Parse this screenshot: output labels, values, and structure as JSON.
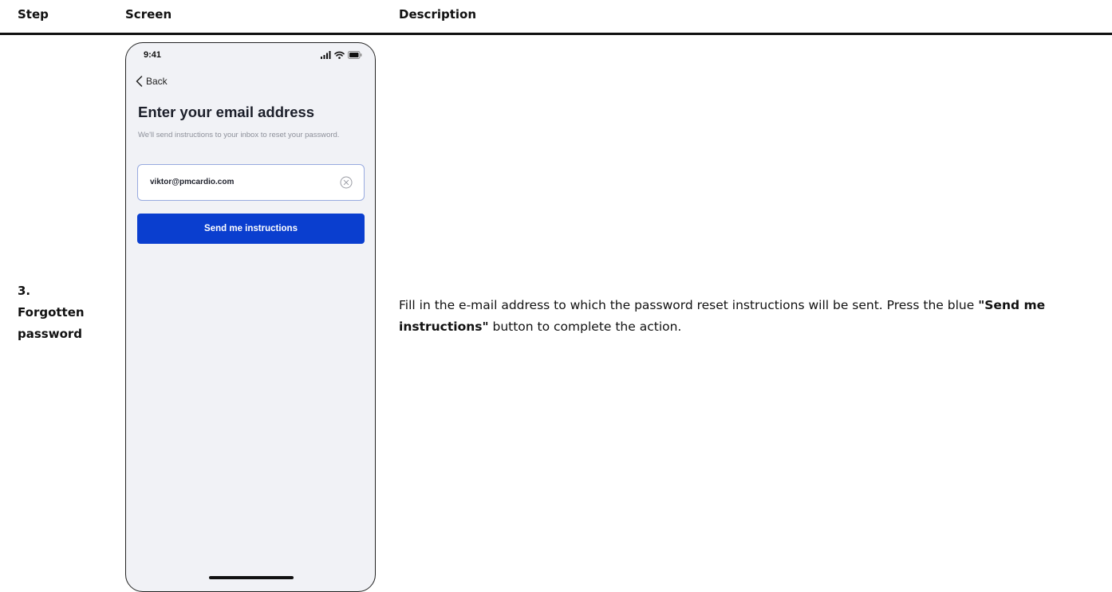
{
  "table": {
    "headers": {
      "step": "Step",
      "screen": "Screen",
      "description": "Description"
    },
    "row": {
      "step_lines": [
        "3.",
        "Forgotten",
        "password"
      ],
      "description_text_1": "Fill in the e-mail address to which the password reset instructions will be sent. Press the blue ",
      "description_bold": "\"Send me instructions\"",
      "description_text_2": " button to complete the action."
    }
  },
  "phone": {
    "status_time": "9:41",
    "status_icons": [
      "signal-icon",
      "wifi-icon",
      "battery-icon"
    ],
    "back_label": "Back",
    "title": "Enter your email address",
    "subtitle": "We'll send instructions to your inbox to reset your password.",
    "email_value": "viktor@pmcardio.com",
    "send_button_label": "Send me instructions",
    "colors": {
      "primary_button": "#0a3ecf",
      "field_border": "#98aadf",
      "screen_background": "#f1f2f6"
    }
  }
}
